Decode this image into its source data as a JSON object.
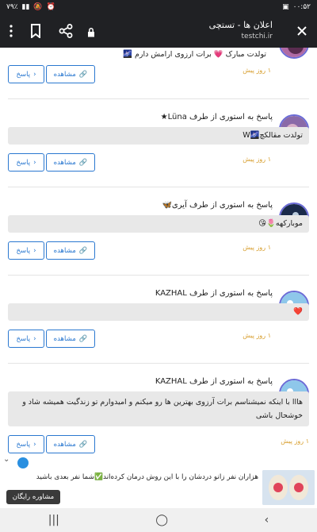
{
  "status_bar": {
    "time": "۰۰:۵۲",
    "battery": "۷۹٪"
  },
  "toolbar": {
    "title": "اعلان ها - تستچی",
    "url": "testchi.ir"
  },
  "posts": [
    {
      "title": "",
      "message": "تولدت مبارک 💗 برات ارزوی ارامش دارم 🌌",
      "time": "۱ روز پیش",
      "view_label": "مشاهده",
      "reply_label": "پاسخ"
    },
    {
      "title": "پاسخ به استوری از طرف Lüna★",
      "message": "تولدت مقالکچ🌌W",
      "time": "۱ روز پیش",
      "view_label": "مشاهده",
      "reply_label": "پاسخ"
    },
    {
      "title": "پاسخ به استوری از طرف آیری🦋",
      "message": "موبارکهه🌷😘",
      "time": "۱ روز پیش",
      "view_label": "مشاهده",
      "reply_label": "پاسخ"
    },
    {
      "title": "پاسخ به استوری از طرف KAZHAL",
      "message": "❤️",
      "time": "۱ روز پیش",
      "view_label": "مشاهده",
      "reply_label": "پاسخ"
    },
    {
      "title": "پاسخ به استوری از طرف KAZHAL",
      "message": "هااا با اینکه نمیشناسم برات آرزوی بهترین ها رو میکنم و امیدوارم تو زندگیت همیشه شاد و خوشحال باشی",
      "time": "۱ روز پیش",
      "view_label": "مشاهده",
      "reply_label": "پاسخ"
    }
  ],
  "ad": {
    "text": "هزاران نفر زانو دردشان را با این روش درمان کرده‌اند✅شما نفر بعدی باشید",
    "cta": "مشاوره رایگان"
  }
}
